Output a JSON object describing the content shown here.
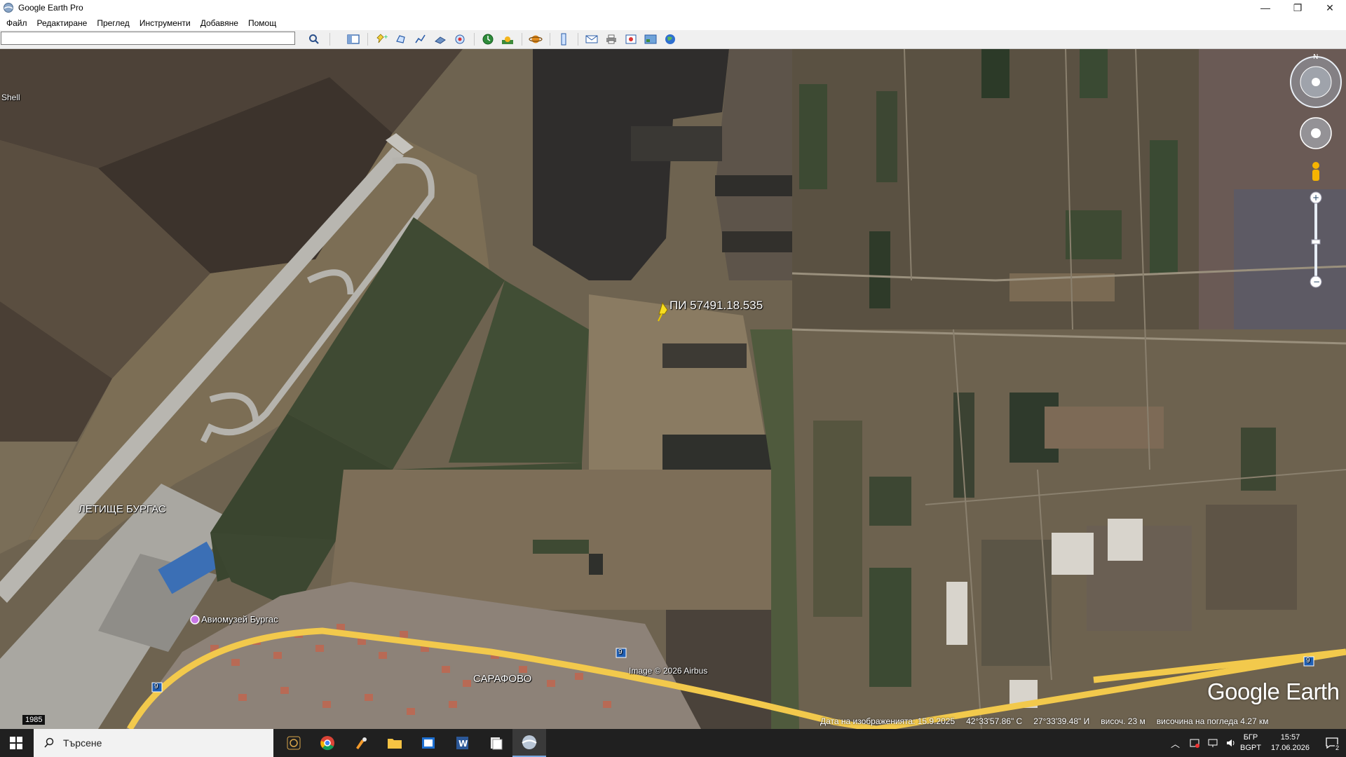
{
  "window": {
    "title": "Google Earth Pro",
    "minimize": "—",
    "maximize": "❐",
    "close": "✕"
  },
  "menu": {
    "items": [
      "Файл",
      "Редактиране",
      "Преглед",
      "Инструменти",
      "Добавяне",
      "Помощ"
    ]
  },
  "toolbar": {
    "search_value": ""
  },
  "map": {
    "placemark": "ПИ 57491.18.535",
    "airport": "ЛЕТИЩЕ БУРГАС",
    "museum": "Авиомузей Бургас",
    "village": "САРАФОВО",
    "shell": "Shell",
    "credit": "Image © 2026 Airbus",
    "road_number": "9",
    "year_badge": "1985",
    "logo": "Google Earth",
    "compass_north": "N"
  },
  "status": {
    "date": "Дата на изображенията: 15.9.2025",
    "lat": "42°33'57.86\" С",
    "lon": "27°33'39.48\" И",
    "elevation": "височ.    23 м",
    "eye_alt": "височина на погледа   4.27 км"
  },
  "taskbar": {
    "search_text": "Търсене",
    "lang_top": "БГР",
    "lang_bottom": "BGPT",
    "time": "15:57",
    "date": "17.06.2026",
    "notif_count": "2"
  },
  "colors": {
    "accent": "#f5d24a",
    "road": "#f2c94c",
    "field_dark": "#2f2d2c",
    "taskbar": "#202020"
  }
}
